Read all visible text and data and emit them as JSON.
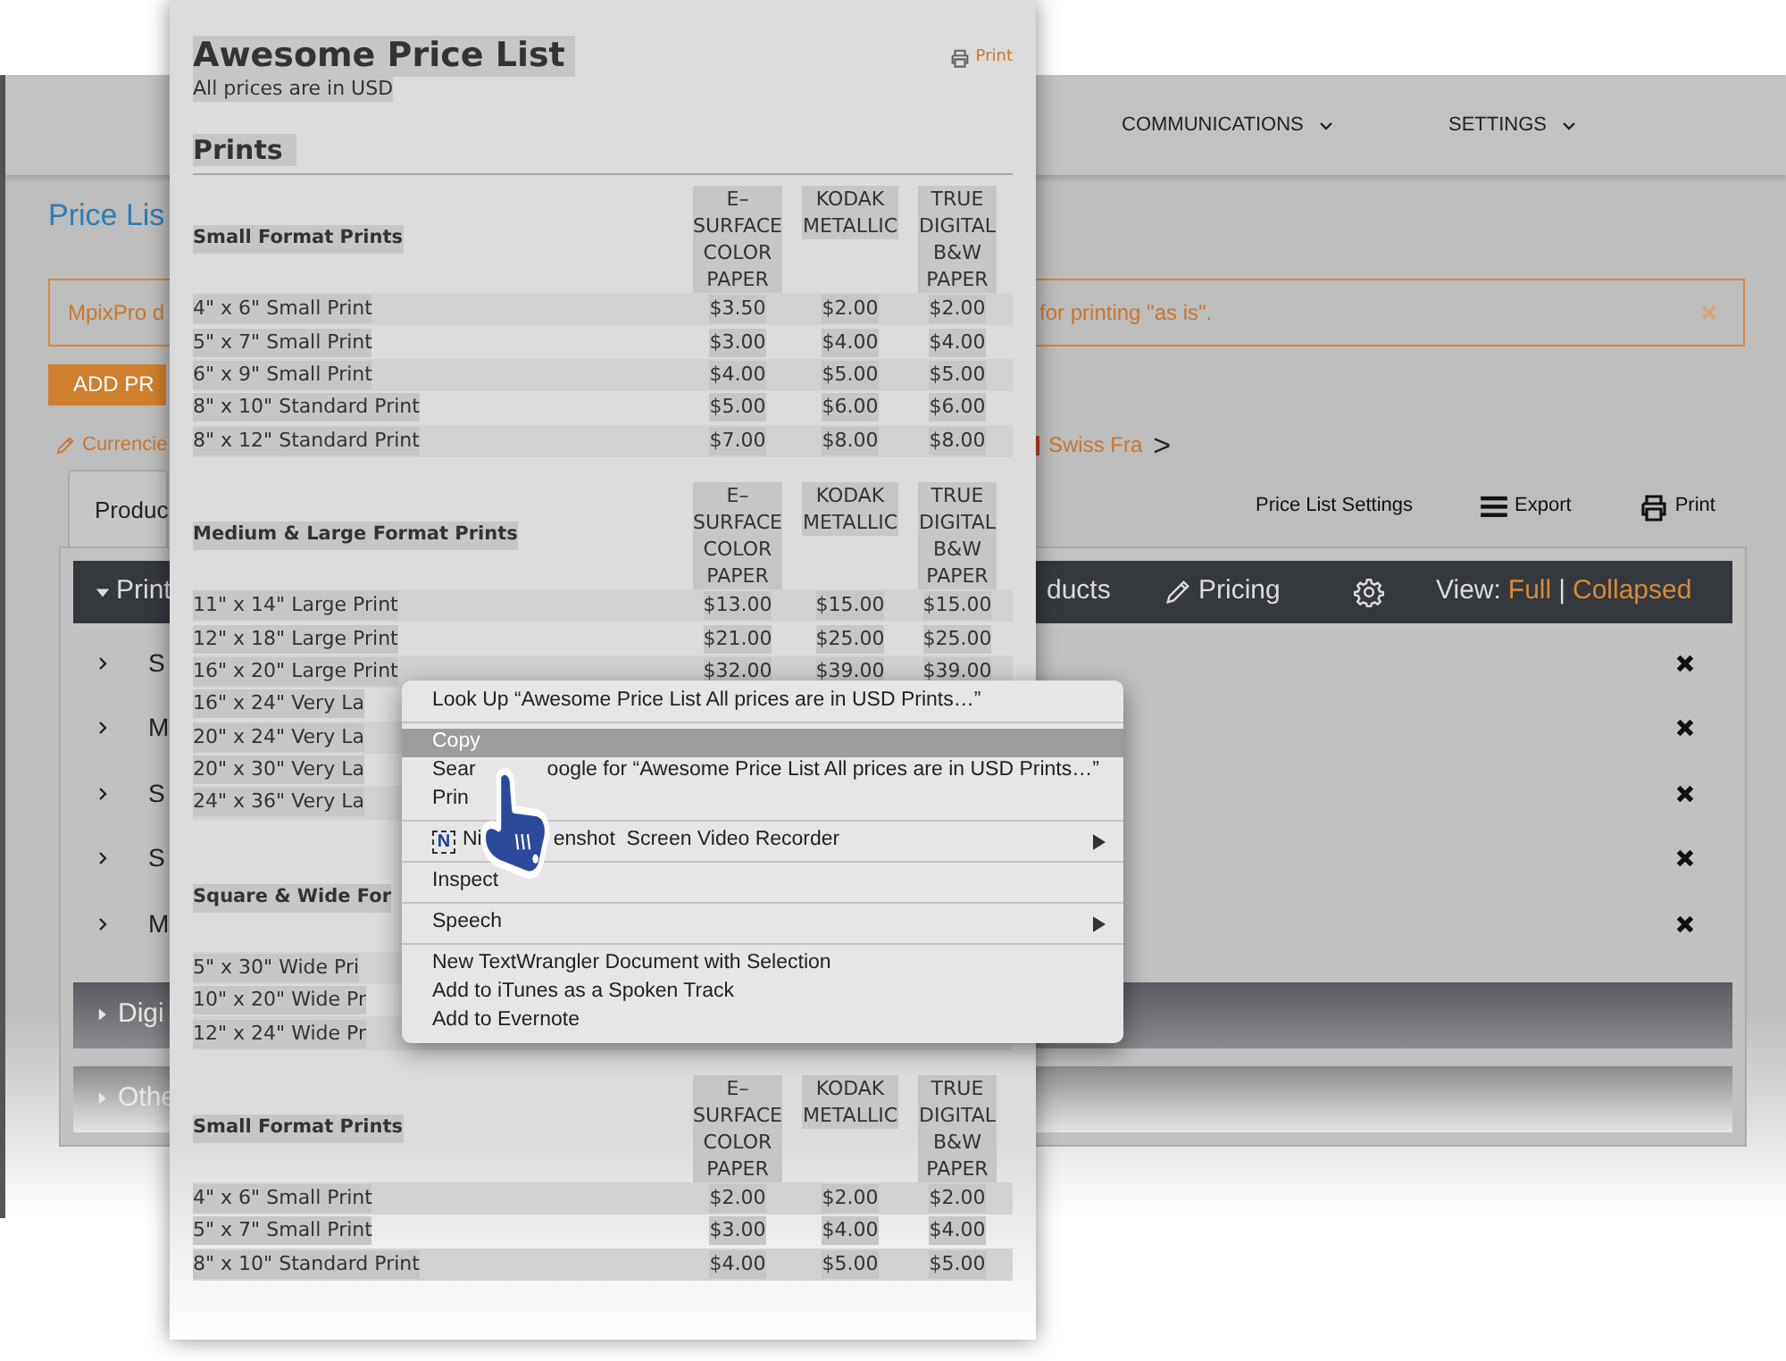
{
  "app": {
    "nav": [
      {
        "label": "COMMUNICATIONS"
      },
      {
        "label": "SETTINGS"
      }
    ],
    "page_title": "Price Lis",
    "alert": {
      "text_left": "MpixPro d",
      "text_right": "for printing \"as is\"."
    },
    "add_button": "ADD PR",
    "currencies": {
      "left": "Currencie",
      "right": "Swiss Fra",
      "next": ">"
    },
    "tab": "Produc",
    "actions": [
      {
        "kind": "settings",
        "label": "Price List Settings"
      },
      {
        "kind": "export",
        "label": "Export"
      },
      {
        "kind": "print",
        "label": "Print"
      }
    ],
    "toolbar": {
      "section": "Print",
      "expanded": true,
      "products": "ducts",
      "pricing": "Pricing",
      "view_label": "View:",
      "view_options": [
        {
          "label": "Full"
        },
        {
          "label": "Collapsed"
        }
      ],
      "separator": "|"
    },
    "rows": [
      {
        "name": "S"
      },
      {
        "name": "M"
      },
      {
        "name": "S"
      },
      {
        "name": "S"
      },
      {
        "name": "M"
      }
    ],
    "collapsed_sections": [
      {
        "label": "Digi",
        "expanded": false
      },
      {
        "label": "Othe",
        "expanded": false
      }
    ]
  },
  "preview": {
    "title": "Awesome Price List",
    "subtitle": "All prices are in USD",
    "print_link": "Print",
    "section": "Prints",
    "tables": [
      {
        "heading": "Small Format Prints",
        "columns": [
          "E–\nSURFACE\nCOLOR\nPAPER",
          "KODAK\nMETALLIC",
          "TRUE\nDIGITAL\nB&W\nPAPER"
        ],
        "rows": [
          {
            "name": "4\" x 6\" Small Print",
            "prices": [
              "$3.50",
              "$2.00",
              "$2.00"
            ]
          },
          {
            "name": "5\" x 7\" Small Print",
            "prices": [
              "$3.00",
              "$4.00",
              "$4.00"
            ]
          },
          {
            "name": "6\" x 9\" Small Print",
            "prices": [
              "$4.00",
              "$5.00",
              "$5.00"
            ]
          },
          {
            "name": "8\" x 10\" Standard Print",
            "prices": [
              "$5.00",
              "$6.00",
              "$6.00"
            ]
          },
          {
            "name": "8\" x 12\" Standard Print",
            "prices": [
              "$7.00",
              "$8.00",
              "$8.00"
            ]
          }
        ]
      },
      {
        "heading": "Medium & Large Format Prints",
        "columns": [
          "E–\nSURFACE\nCOLOR\nPAPER",
          "KODAK\nMETALLIC",
          "TRUE\nDIGITAL\nB&W\nPAPER"
        ],
        "rows": [
          {
            "name": "11\" x 14\" Large Print",
            "prices": [
              "$13.00",
              "$15.00",
              "$15.00"
            ]
          },
          {
            "name": "12\" x 18\" Large Print",
            "prices": [
              "$21.00",
              "$25.00",
              "$25.00"
            ]
          },
          {
            "name": "16\" x 20\" Large Print",
            "prices": [
              "$32.00",
              "$39.00",
              "$39.00"
            ]
          },
          {
            "name": "16\" x 24\" Very La"
          },
          {
            "name": "20\" x 24\" Very La"
          },
          {
            "name": "20\" x 30\" Very La"
          },
          {
            "name": "24\" x 36\" Very La"
          }
        ]
      },
      {
        "heading": "Square & Wide For",
        "rows": [
          {
            "name": "5\" x 30\" Wide Pri"
          },
          {
            "name": "10\" x 20\" Wide Pr"
          },
          {
            "name": "12\" x 24\" Wide Pr"
          }
        ]
      },
      {
        "heading": "Small Format Prints",
        "columns": [
          "E–\nSURFACE\nCOLOR\nPAPER",
          "KODAK\nMETALLIC",
          "TRUE\nDIGITAL\nB&W\nPAPER"
        ],
        "rows": [
          {
            "name": "4\" x 6\" Small Print",
            "prices": [
              "$2.00",
              "$2.00",
              "$2.00"
            ]
          },
          {
            "name": "5\" x 7\" Small Print",
            "prices": [
              "$3.00",
              "$4.00",
              "$4.00"
            ]
          },
          {
            "name": "8\" x 10\" Standard Print",
            "prices": [
              "$4.00",
              "$5.00",
              "$5.00"
            ]
          }
        ]
      }
    ]
  },
  "context_menu": {
    "groups": [
      [
        {
          "parts": [
            "Look Up “Awesome Price List All prices are in USD Prints…”"
          ],
          "highlighted": false,
          "submenu": false
        }
      ],
      [
        {
          "parts": [
            "Copy"
          ],
          "highlighted": true,
          "submenu": false
        },
        {
          "parts": [
            "Sear",
            "oogle for “Awesome Price List All prices are in USD Prints…”"
          ],
          "highlighted": false,
          "submenu": false
        },
        {
          "parts": [
            "Prin"
          ],
          "highlighted": false,
          "submenu": false
        }
      ],
      [
        {
          "parts": [
            "Ni",
            "enshot  Screen Video Recorder"
          ],
          "icon_text": "N",
          "highlighted": false,
          "submenu": true
        }
      ],
      [
        {
          "parts": [
            "Inspect"
          ],
          "highlighted": false,
          "submenu": false
        }
      ],
      [
        {
          "parts": [
            "Speech"
          ],
          "highlighted": false,
          "submenu": true
        }
      ],
      [
        {
          "parts": [
            "New TextWrangler Document with Selection"
          ],
          "highlighted": false,
          "submenu": false
        },
        {
          "parts": [
            "Add to iTunes as a Spoken Track"
          ],
          "highlighted": false,
          "submenu": false
        },
        {
          "parts": [
            "Add to Evernote"
          ],
          "highlighted": false,
          "submenu": false
        }
      ]
    ]
  }
}
